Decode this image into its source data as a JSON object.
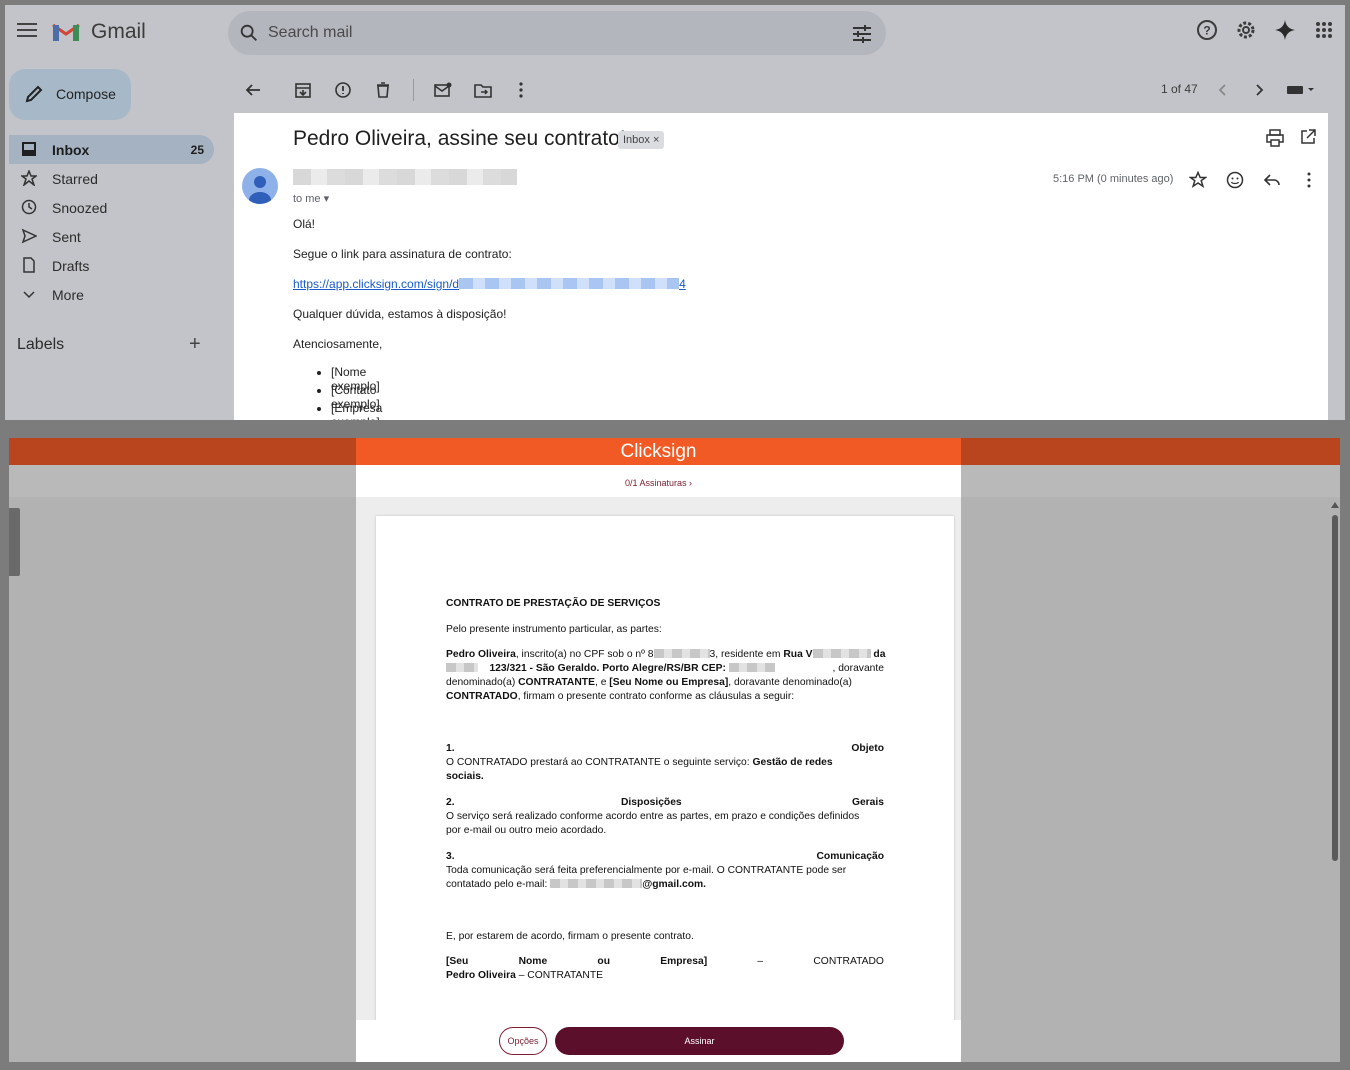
{
  "gmail": {
    "app_name": "Gmail",
    "search_placeholder": "Search mail",
    "compose_label": "Compose",
    "nav": [
      {
        "label": "Inbox",
        "count": "25",
        "icon": "inbox-icon"
      },
      {
        "label": "Starred",
        "count": "",
        "icon": "star-icon"
      },
      {
        "label": "Snoozed",
        "count": "",
        "icon": "clock-icon"
      },
      {
        "label": "Sent",
        "count": "",
        "icon": "send-icon"
      },
      {
        "label": "Drafts",
        "count": "",
        "icon": "draft-icon"
      },
      {
        "label": "More",
        "count": "",
        "icon": "chevron-down-icon"
      }
    ],
    "labels_heading": "Labels",
    "pagination": "1 of 47",
    "email": {
      "subject": "Pedro Oliveira, assine seu contrato!",
      "badge": "Inbox ×",
      "to": "to me",
      "time": "5:16 PM (0 minutes ago)",
      "greeting": "Olá!",
      "line1": "Segue o link para assinatura de contrato:",
      "link_start": "https://app.clicksign.com/sign/d",
      "link_end": "4",
      "line2": "Qualquer dúvida, estamos à disposição!",
      "signoff": "Atenciosamente,",
      "bullets": [
        "[Nome exemplo]",
        "[Contato exemplo]",
        "[Empresa exemplo]"
      ]
    },
    "colors": {
      "accent": "#1a5bc8",
      "active_nav": "#a5b2c2"
    }
  },
  "clicksign": {
    "logo": "Clicksign",
    "signatures_status": "0/1 Assinaturas",
    "document": {
      "title": "CONTRATO DE PRESTAÇÃO DE SERVIÇOS",
      "intro": "Pelo presente instrumento particular, as partes:",
      "p1_name": "Pedro Oliveira",
      "p1_a": ", inscrito(a) no CPF sob o nº 8",
      "p1_b": "3, residente em ",
      "p1_rua": "Rua V",
      "p1_da": "da",
      "p2_num": "123/321 - São Geraldo. Porto Alegre/RS/BR CEP:",
      "p2_end": ", doravante",
      "p3_a": "denominado(a) ",
      "p3_contratante": "CONTRATANTE",
      "p3_b": ", e ",
      "p3_empresa": "[Seu Nome ou Empresa]",
      "p3_c": ", doravante denominado(a)",
      "p4_contratado": "CONTRATADO",
      "p4_rest": ", firmam o presente contrato conforme as cláusulas a seguir:",
      "c1_num": "1.",
      "c1_title": "Objeto",
      "c1_text_a": " O CONTRATADO prestará ao CONTRATANTE o seguinte serviço: ",
      "c1_text_b": "Gestão de redes",
      "c1_text_c": "sociais",
      "c2_num": "2.",
      "c2_mid": "Disposições",
      "c2_title": "Gerais",
      "c2_text_a": " O serviço será realizado conforme acordo entre as partes, em prazo e condições definidos",
      "c2_text_b": "por e-mail ou outro meio acordado.",
      "c3_num": "3.",
      "c3_title": "Comunicação",
      "c3_text_a": " Toda comunicação será feita preferencialmente por e-mail. O CONTRATANTE pode ser",
      "c3_text_b": "contatado pelo e-mail: ",
      "c3_email": "@gmail.com",
      "closing": "E, por estarem de acordo, firmam o presente contrato.",
      "sig1": [
        "[Seu",
        "Nome",
        "ou",
        "Empresa]",
        "–",
        "CONTRATADO"
      ],
      "sig2_name": "Pedro Oliveira",
      "sig2_rest": " – CONTRATANTE"
    },
    "options_label": "Opções",
    "sign_label": "Assinar",
    "colors": {
      "brand": "#f15a24",
      "button": "#5c0f2b"
    }
  }
}
